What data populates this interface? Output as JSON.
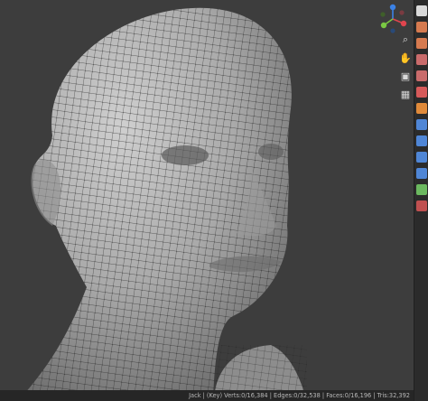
{
  "status": {
    "text": "Jack | (Key) Verts:0/16,384 | Edges:0/32,538 | Faces:0/16,196 | Tris:32,392"
  },
  "gizmo": {
    "axes": [
      {
        "name": "x-axis",
        "color": "#e0454e"
      },
      {
        "name": "y-axis",
        "color": "#7ac943"
      },
      {
        "name": "z-axis",
        "color": "#3b82e6"
      }
    ]
  },
  "nav_tools": [
    {
      "name": "zoom-icon",
      "glyph": "⌕"
    },
    {
      "name": "pan-hand-icon",
      "glyph": "✋"
    },
    {
      "name": "camera-icon",
      "glyph": "▣"
    },
    {
      "name": "grid-icon",
      "glyph": "▦"
    }
  ],
  "sidebar_tabs": [
    {
      "name": "tool-tab-icon",
      "color": "#d9d9d9"
    },
    {
      "name": "render-tab-icon",
      "color": "#d67a4f"
    },
    {
      "name": "output-tab-icon",
      "color": "#d67a4f"
    },
    {
      "name": "view-layer-tab-icon",
      "color": "#c96b6b"
    },
    {
      "name": "scene-tab-icon",
      "color": "#c96b6b"
    },
    {
      "name": "world-tab-icon",
      "color": "#d65a5a"
    },
    {
      "name": "object-tab-icon",
      "color": "#e08a3a"
    },
    {
      "name": "modifier-tab-icon",
      "color": "#4f86d6"
    },
    {
      "name": "particles-tab-icon",
      "color": "#4f86d6"
    },
    {
      "name": "physics-tab-icon",
      "color": "#4f86d6"
    },
    {
      "name": "constraints-tab-icon",
      "color": "#4f86d6"
    },
    {
      "name": "data-tab-icon",
      "color": "#6bb85f"
    },
    {
      "name": "material-tab-icon",
      "color": "#c05050"
    }
  ]
}
